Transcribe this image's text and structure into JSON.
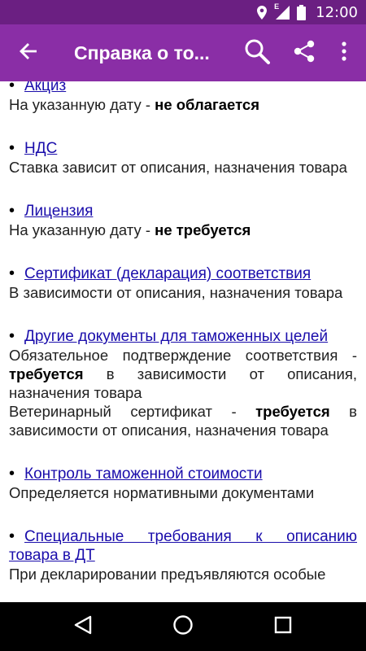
{
  "status": {
    "network_letter": "E",
    "time": "12:00"
  },
  "app_bar": {
    "title": "Справка о то..."
  },
  "items": [
    {
      "title": "Акциз",
      "parts": [
        {
          "t": "На указанную дату - ",
          "b": false
        },
        {
          "t": "не облагается",
          "b": true
        }
      ]
    },
    {
      "title": "НДС",
      "parts": [
        {
          "t": "Ставка зависит от описания, назначения товара",
          "b": false
        }
      ]
    },
    {
      "title": "Лицензия",
      "parts": [
        {
          "t": "На указанную дату - ",
          "b": false
        },
        {
          "t": "не требуется",
          "b": true
        }
      ]
    },
    {
      "title": "Сертификат (декларация) соответствия",
      "parts": [
        {
          "t": "В зависимости от описания, назначения товара",
          "b": false
        }
      ]
    },
    {
      "title": "Другие документы для таможенных целей",
      "parts": [
        {
          "t": "Обязательное подтверждение соответствия - ",
          "b": false
        },
        {
          "t": "требуется",
          "b": true
        },
        {
          "t": " в зависимости от описания, назначения товара",
          "b": false
        }
      ],
      "parts2": [
        {
          "t": "Ветеринарный сертификат - ",
          "b": false
        },
        {
          "t": "требуется",
          "b": true
        },
        {
          "t": " в зависимости от описания, назначения товара",
          "b": false
        }
      ]
    },
    {
      "title": "Контроль таможенной стоимости",
      "parts": [
        {
          "t": "Определяется нормативными документами",
          "b": false
        }
      ]
    },
    {
      "title_line1": "Специальные требования к описанию",
      "title_line2": "товара в ДТ",
      "parts": [
        {
          "t": "При декларировании предъявляются особые",
          "b": false
        }
      ]
    }
  ],
  "colors": {
    "status_bar": "#6b1f82",
    "app_bar": "#8a2ea6",
    "link": "#1a0dab",
    "nav_bar": "#000000"
  },
  "icons": {
    "status": [
      "location-icon",
      "signal-icon",
      "battery-icon"
    ],
    "app_bar": [
      "back-arrow-icon",
      "search-icon",
      "share-icon",
      "more-vert-icon"
    ],
    "nav": [
      "nav-back-icon",
      "nav-home-icon",
      "nav-recents-icon"
    ]
  }
}
